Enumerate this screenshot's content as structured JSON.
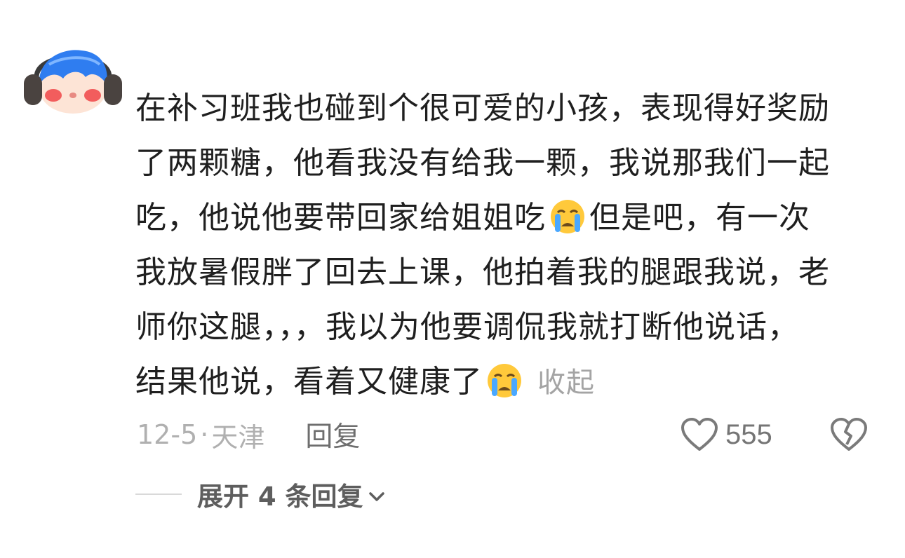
{
  "comment": {
    "lines": [
      {
        "text": "在补习班我也碰到个很可爱的小孩，表现得好奖励"
      },
      {
        "text": "了两颗糖，他看我没有给我一颗，我说那我们一起"
      },
      {
        "before": "吃，他说他要带回家给姐姐吃",
        "emoji": "loudly-crying-face",
        "after": "但是吧，有一次"
      },
      {
        "text": "我放暑假胖了回去上课，他拍着我的腿跟我说，老"
      },
      {
        "text": "师你这腿，，，我以为他要调侃我就打断他说话，"
      },
      {
        "before": "结果他说，看着又健康了",
        "emoji": "loudly-crying-face",
        "after": ""
      }
    ],
    "collapse_label": "收起",
    "date": "12-5",
    "separator": "·",
    "location": "天津",
    "reply_label": "回复",
    "like_count": "555",
    "expand_label": "展开 4 条回复",
    "icons": {
      "like": "heart-outline-icon",
      "dislike": "broken-heart-icon",
      "expand": "chevron-down-icon"
    },
    "colors": {
      "text": "#1f1f1f",
      "muted": "#b0b0b0",
      "link": "#a4a4a4",
      "avatar_hair": "#2f7df0"
    }
  }
}
